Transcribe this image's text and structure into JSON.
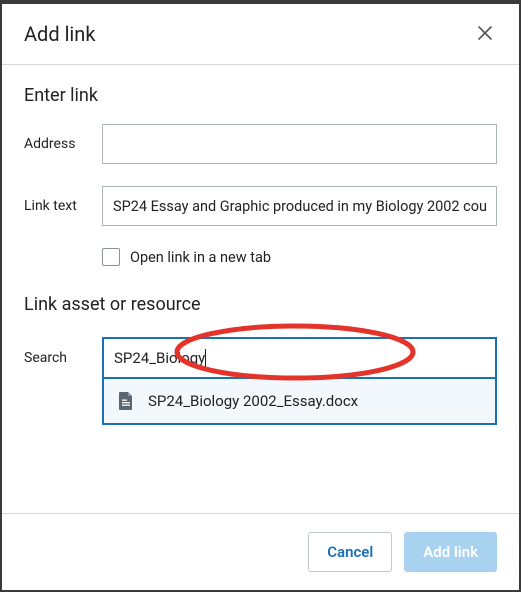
{
  "dialog": {
    "title": "Add link",
    "sections": {
      "enter_link": {
        "heading": "Enter link",
        "address_label": "Address",
        "address_value": "",
        "link_text_label": "Link text",
        "link_text_value": "SP24 Essay and Graphic produced in my Biology 2002 cou",
        "open_new_tab_label": "Open link in a new tab",
        "open_new_tab_checked": false
      },
      "link_asset": {
        "heading": "Link asset or resource",
        "search_label": "Search",
        "search_value": "SP24_Biology",
        "suggestions": [
          {
            "icon": "file-doc-icon",
            "label": "SP24_Biology 2002_Essay.docx"
          }
        ]
      }
    },
    "footer": {
      "cancel": "Cancel",
      "submit": "Add link"
    }
  }
}
